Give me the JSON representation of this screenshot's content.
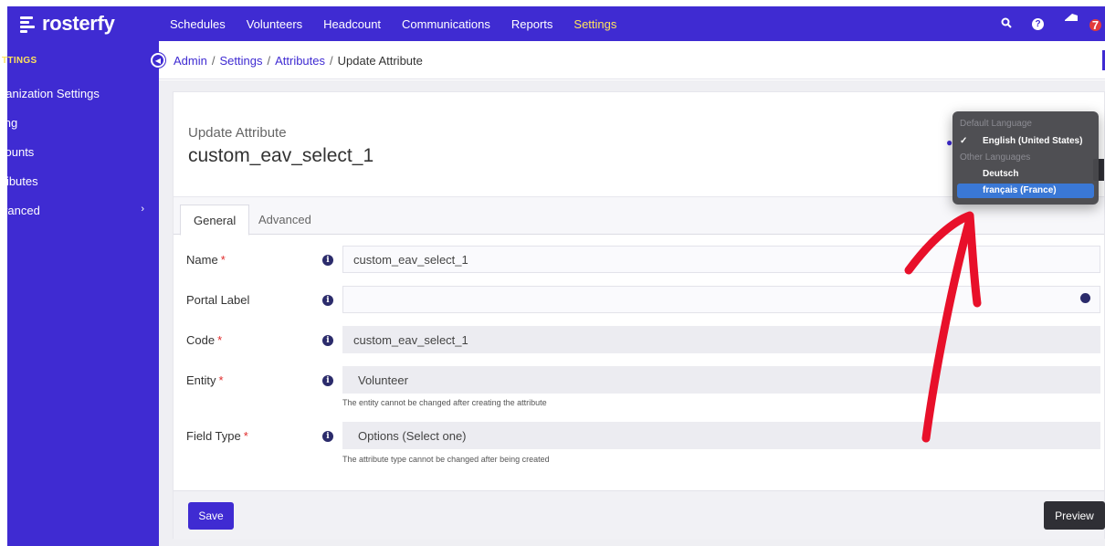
{
  "brand": {
    "name": "rosterfy"
  },
  "nav": {
    "items": [
      "Schedules",
      "Volunteers",
      "Headcount",
      "Communications",
      "Reports",
      "Settings"
    ],
    "active_index": 5,
    "notification_count": "7"
  },
  "sidebar": {
    "heading": "TTINGS",
    "items": [
      "ganization Settings",
      "ling",
      "counts",
      "tributes",
      "lvanced"
    ]
  },
  "breadcrumb": {
    "items": [
      "Admin",
      "Settings",
      "Attributes"
    ],
    "separator": "/",
    "current": "Update Attribute"
  },
  "header": {
    "subtitle": "Update Attribute",
    "title": "custom_eav_select_1"
  },
  "tabs": [
    "General",
    "Advanced"
  ],
  "form": {
    "name": {
      "label": "Name",
      "value": "custom_eav_select_1"
    },
    "portal_label": {
      "label": "Portal Label",
      "value": ""
    },
    "code": {
      "label": "Code",
      "value": "custom_eav_select_1"
    },
    "entity": {
      "label": "Entity",
      "value": "Volunteer",
      "help": "The entity cannot be changed after creating the attribute"
    },
    "field_type": {
      "label": "Field Type",
      "value": "Options (Select one)",
      "help": "The attribute type cannot be changed after being created"
    },
    "required_marker": "*",
    "info_glyph": "i"
  },
  "buttons": {
    "save": "Save",
    "preview": "Preview"
  },
  "language_dropdown": {
    "default_heading": "Default Language",
    "default_option": "English (United States)",
    "other_heading": "Other Languages",
    "other_options": [
      "Deutsch",
      "français (France)"
    ],
    "highlighted": "français (France)",
    "check_glyph": "✓"
  },
  "colors": {
    "brand": "#3f2bd2",
    "active_nav": "#ffe45c",
    "required": "#e02b2b",
    "annotation_arrow": "#e8102a"
  },
  "icons": [
    "search-icon",
    "help-icon",
    "notifications-icon",
    "globe-icon",
    "info-icon",
    "collapse-icon",
    "chevron-right-icon"
  ]
}
